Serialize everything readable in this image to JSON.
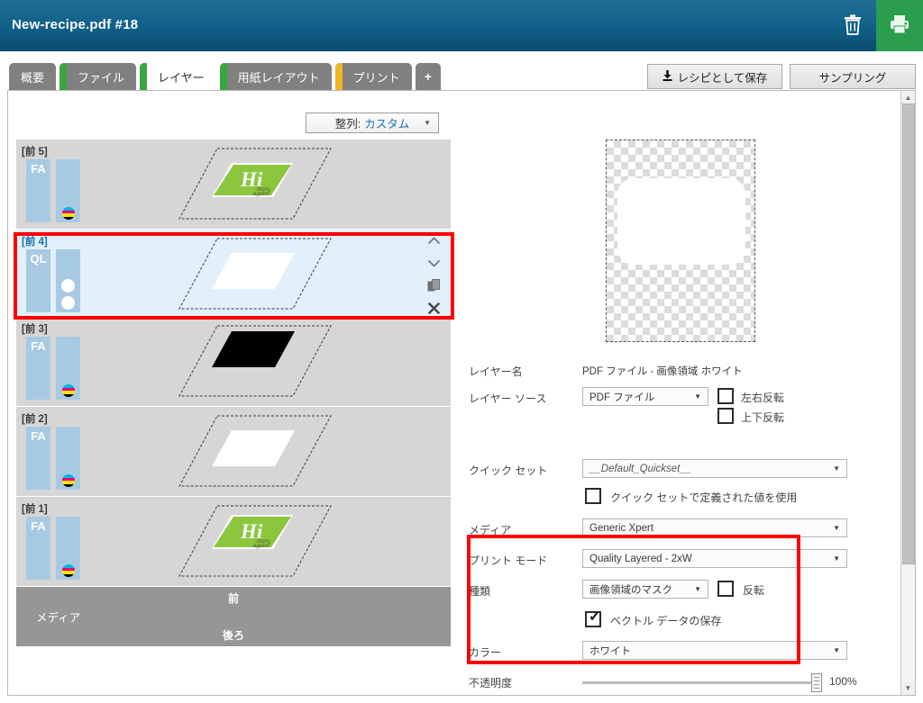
{
  "window": {
    "title": "New-recipe.pdf #18",
    "trash_icon": "trash-icon",
    "print_icon": "printer-icon"
  },
  "tabs": [
    {
      "label": "概要",
      "stripe": "",
      "active": false
    },
    {
      "label": "ファイル",
      "stripe": "#3aa642",
      "active": false
    },
    {
      "label": "レイヤー",
      "stripe": "#3aa642",
      "active": true
    },
    {
      "label": "用紙レイアウト",
      "stripe": "#3aa642",
      "active": false
    },
    {
      "label": "プリント",
      "stripe": "#f0b726",
      "active": false
    },
    {
      "label": "+",
      "stripe": "",
      "active": false
    }
  ],
  "toolbar": {
    "save_recipe_label": "レシピとして保存",
    "save_recipe_icon": "download-icon",
    "sampling_label": "サンプリング"
  },
  "layers_panel": {
    "align_select": {
      "label": "整列:",
      "value": "カスタム"
    },
    "rows": [
      {
        "name": "[前 5]",
        "badge": "FA",
        "ink": "cmyk",
        "art": "logo",
        "selected": false
      },
      {
        "name": "[前 4]",
        "badge": "QL",
        "ink": "white-double",
        "art": "white-shape",
        "selected": true,
        "actions": [
          "move-up",
          "move-down",
          "duplicate",
          "delete"
        ]
      },
      {
        "name": "[前 3]",
        "badge": "FA",
        "ink": "cmyk",
        "art": "black-shape",
        "selected": false
      },
      {
        "name": "[前 2]",
        "badge": "FA",
        "ink": "cmyk",
        "art": "white-shape",
        "selected": false
      },
      {
        "name": "[前 1]",
        "badge": "FA",
        "ink": "cmyk",
        "art": "logo",
        "selected": false
      }
    ],
    "media_row": {
      "front": "前",
      "back": "後ろ",
      "name": "メディア"
    }
  },
  "form": {
    "layer_name_label": "レイヤー名",
    "layer_name_value": "PDF ファイル - 画像領域 ホワイト",
    "layer_source_label": "レイヤー ソース",
    "layer_source_value": "PDF ファイル",
    "flip_h_label": "左右反転",
    "flip_v_label": "上下反転",
    "quickset_label": "クイック セット",
    "quickset_value": "__Default_Quickset__",
    "use_quickset_label": "クイック セットで定義された値を使用",
    "media_label": "メディア",
    "media_value": "Generic Xpert",
    "printmode_label": "プリント モード",
    "printmode_value": "Quality Layered - 2xW",
    "type_label": "種類",
    "type_value": "画像領域のマスク",
    "invert_label": "反転",
    "keep_vector_label": "ベクトル データの保存",
    "color_label": "カラー",
    "color_value": "ホワイト",
    "opacity_label": "不透明度",
    "opacity_value": "100%"
  },
  "colors": {
    "title_bar": "#0f5f88",
    "print_green": "#2a9d4e",
    "tab_inactive": "#808080",
    "tab_stripe_green": "#3aa642",
    "tab_stripe_yellow": "#f0b726",
    "highlight_red": "#ff0000",
    "selected_row": "#e2f0fb",
    "badge_blue": "#a8c9e2",
    "logo_green": "#8cc63f"
  }
}
